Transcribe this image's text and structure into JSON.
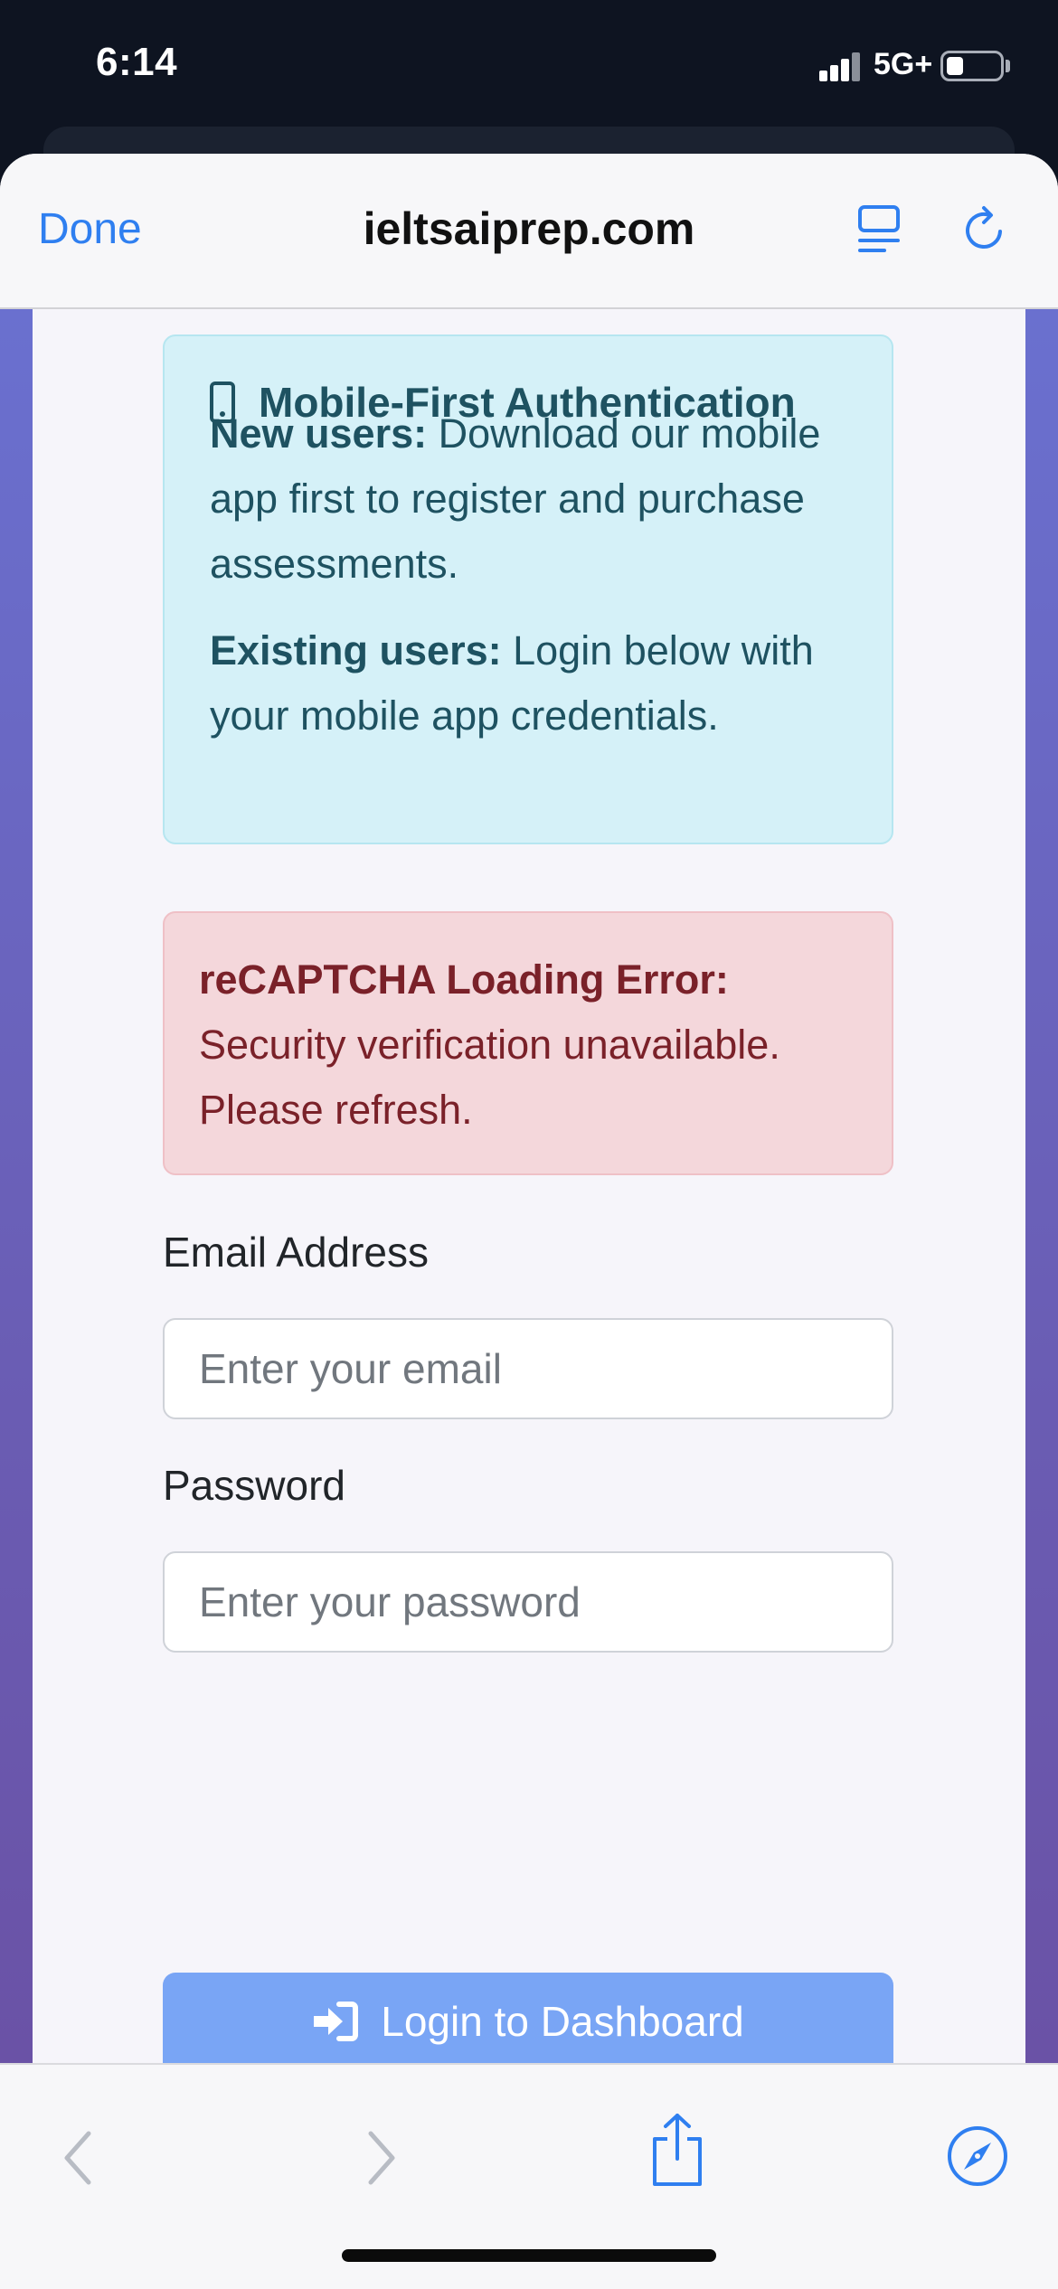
{
  "status_bar": {
    "time": "6:14",
    "network": "5G+"
  },
  "browser": {
    "done_label": "Done",
    "url": "ieltsaiprep.com",
    "icons": [
      "reader-icon",
      "reload-icon",
      "back-icon",
      "forward-icon",
      "share-icon",
      "compass-icon"
    ]
  },
  "info_box": {
    "icon": "mobile-phone-icon",
    "heading": "Mobile-First Authentication",
    "new_users_label": "New users:",
    "new_users_text": " Download our mobile app first to register and purchase assessments.",
    "existing_users_label": "Existing users:",
    "existing_users_text": " Login below with your mobile app credentials."
  },
  "error_box": {
    "title": "reCAPTCHA Loading Error:",
    "message": " Security verification unavailable. Please refresh."
  },
  "form": {
    "email_label": "Email Address",
    "email_placeholder": "Enter your email",
    "password_label": "Password",
    "password_placeholder": "Enter your password",
    "login_button_label": "Login to Dashboard",
    "login_icon": "sign-in-icon"
  },
  "colors": {
    "accent": "#2f7ff0",
    "info_bg": "#d5f1f8",
    "info_text": "#1e5261",
    "error_bg": "#f4d7db",
    "error_text": "#7a2129",
    "button_bg": "#79a5f5",
    "page_gradient_top": "#6a70cf",
    "page_gradient_bottom": "#6a52a6"
  }
}
